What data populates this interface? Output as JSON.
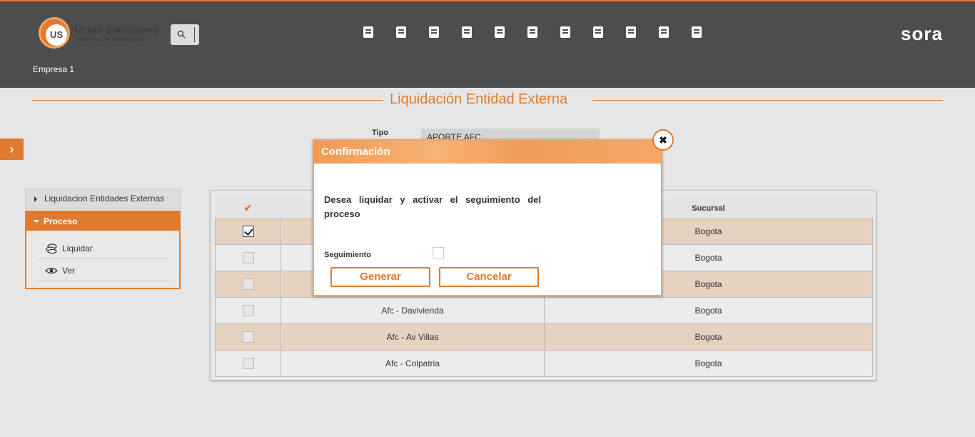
{
  "header": {
    "logo_mark": "US",
    "logo_title": "Unión Soluciones",
    "logo_subtitle": "Sistemas de Información",
    "brand": "sora",
    "company": "Empresa 1",
    "modules": [
      "edit-doc-icon",
      "user-tie-icon",
      "gift-icon",
      "hierarchy-icon",
      "user-card-icon",
      "stopwatch-icon",
      "report-icon",
      "presentation-icon",
      "gears-icon",
      "medical-bag-icon",
      "search-user-icon"
    ],
    "accent": "#e07a2e",
    "bg": "#4d4d4d"
  },
  "page": {
    "title": "Liquidación Entidad Externa",
    "tipo_label": "Tipo",
    "tipo_value": "APORTE AFC"
  },
  "sidebar": {
    "item1": "Liquidacion Entidades Externas",
    "group": "Proceso",
    "sub_items": [
      {
        "label": "Liquidar",
        "icon": "coins-icon"
      },
      {
        "label": "Ver",
        "icon": "eye-icon"
      }
    ]
  },
  "grid": {
    "columns": [
      "✔",
      "",
      "Sucursal"
    ],
    "rows": [
      {
        "checked": true,
        "entity": "",
        "sucursal": "Bogota"
      },
      {
        "checked": false,
        "entity": "",
        "sucursal": "Bogota"
      },
      {
        "checked": false,
        "entity": "",
        "sucursal": "Bogota"
      },
      {
        "checked": false,
        "entity": "Afc - Davivienda",
        "sucursal": "Bogota"
      },
      {
        "checked": false,
        "entity": "Afc - Av Villas",
        "sucursal": "Bogota"
      },
      {
        "checked": false,
        "entity": "Afc - Colpatria",
        "sucursal": "Bogota"
      }
    ]
  },
  "dialog": {
    "title": "Confirmación",
    "message": "Desea liquidar y activar el seguimiento del proceso",
    "seguimiento_label": "Seguimiento",
    "generate_label": "Generar",
    "cancel_label": "Cancelar",
    "close_symbol": "✖"
  }
}
